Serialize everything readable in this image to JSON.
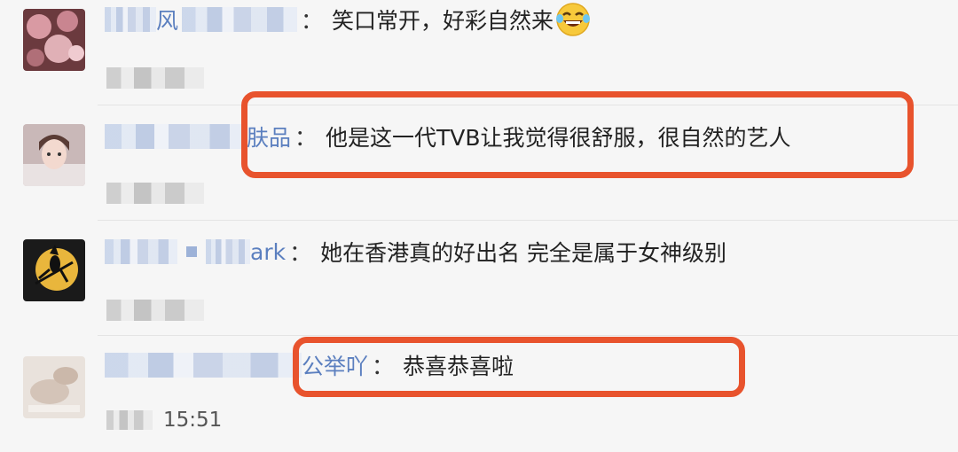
{
  "comments": [
    {
      "name_visible": "风",
      "text": "笑口常开，好彩自然来",
      "emoji": "laughing-tears-emoji",
      "avatar": "magnolia-flowers-photo"
    },
    {
      "name_visible": "肤品",
      "text": "他是这一代TVB让我觉得很舒服，很自然的艺人",
      "avatar": "girl-portrait-photo"
    },
    {
      "name_visible": "ark",
      "text": "她在香港真的好出名 完全是属于女神级别",
      "avatar": "witch-moon-silhouette"
    },
    {
      "name_visible": "公举吖",
      "text": "恭喜恭喜啦",
      "meta_visible": "15:51",
      "avatar": "pale-photo"
    }
  ],
  "colon": "：",
  "colors": {
    "highlight": "#e8532d",
    "name": "#5b7fbf",
    "text": "#222222"
  }
}
